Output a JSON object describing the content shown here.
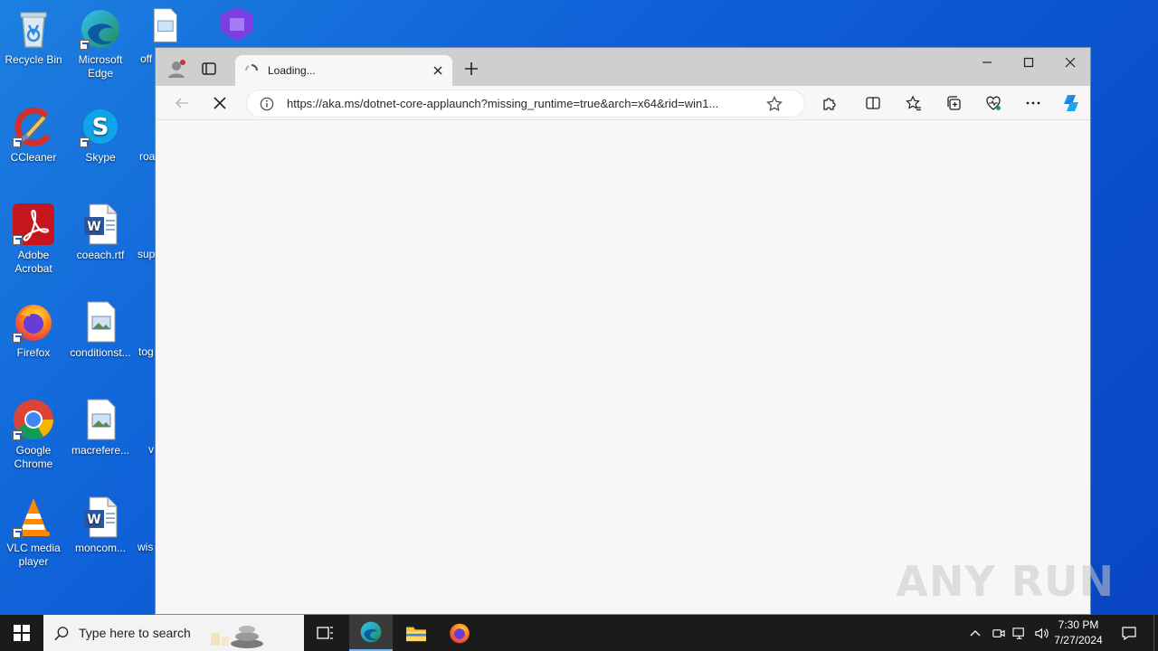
{
  "desktop": {
    "icons": [
      {
        "label": "Recycle Bin",
        "icon": "recycle-bin-icon"
      },
      {
        "label": "Microsoft Edge",
        "icon": "edge-icon"
      },
      {
        "label": "CCleaner",
        "icon": "ccleaner-icon"
      },
      {
        "label": "Skype",
        "icon": "skype-icon"
      },
      {
        "label": "Adobe Acrobat",
        "icon": "acrobat-icon"
      },
      {
        "label": "coeach.rtf",
        "icon": "word-doc-icon"
      },
      {
        "label": "Firefox",
        "icon": "firefox-icon"
      },
      {
        "label": "conditionst...",
        "icon": "image-file-icon"
      },
      {
        "label": "Google Chrome",
        "icon": "chrome-icon"
      },
      {
        "label": "macrefere...",
        "icon": "image-file-icon"
      },
      {
        "label": "VLC media player",
        "icon": "vlc-icon"
      },
      {
        "label": "moncom...",
        "icon": "word-doc-icon"
      }
    ],
    "partial_labels": [
      "off",
      "roa",
      "sup",
      "tog",
      "v",
      "wis"
    ]
  },
  "browser": {
    "tab_title": "Loading...",
    "url": "https://aka.ms/dotnet-core-applaunch?missing_runtime=true&arch=x64&rid=win1...",
    "state": "loading"
  },
  "taskbar": {
    "search_placeholder": "Type here to search",
    "time": "7:30 PM",
    "date": "7/27/2024"
  },
  "watermark": "ANY RUN"
}
